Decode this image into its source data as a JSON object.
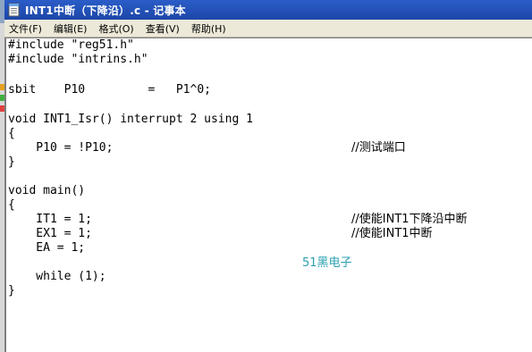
{
  "window": {
    "title": "INT1中断（下降沿）.c - 记事本",
    "icon": "notepad-icon",
    "title_bar_color": "#1c46a8"
  },
  "menu": [
    {
      "label": "文件(F)"
    },
    {
      "label": "编辑(E)"
    },
    {
      "label": "格式(O)"
    },
    {
      "label": "查看(V)"
    },
    {
      "label": "帮助(H)"
    }
  ],
  "code": [
    {
      "text": "#include \"reg51.h\"",
      "comment": ""
    },
    {
      "text": "#include \"intrins.h\"",
      "comment": ""
    },
    {
      "text": "",
      "comment": ""
    },
    {
      "text": "sbit    P10         =   P1^0;",
      "comment": ""
    },
    {
      "text": "",
      "comment": ""
    },
    {
      "text": "void INT1_Isr() interrupt 2 using 1",
      "comment": ""
    },
    {
      "text": "{",
      "comment": ""
    },
    {
      "text": "    P10 = !P10;",
      "comment": "//测试端口"
    },
    {
      "text": "}",
      "comment": ""
    },
    {
      "text": "",
      "comment": ""
    },
    {
      "text": "void main()",
      "comment": ""
    },
    {
      "text": "{",
      "comment": ""
    },
    {
      "text": "    IT1 = 1;",
      "comment": "//使能INT1下降沿中断"
    },
    {
      "text": "    EX1 = 1;",
      "comment": "//使能INT1中断"
    },
    {
      "text": "    EA = 1;",
      "comment": ""
    },
    {
      "text": "",
      "comment": ""
    },
    {
      "text": "    while (1);",
      "comment": ""
    },
    {
      "text": "}",
      "comment": ""
    }
  ],
  "watermark": {
    "text": "51黑电子",
    "color": "#2a9fb0"
  },
  "edge_marks": [
    "#e8a020",
    "#40b040",
    "#e04040"
  ]
}
